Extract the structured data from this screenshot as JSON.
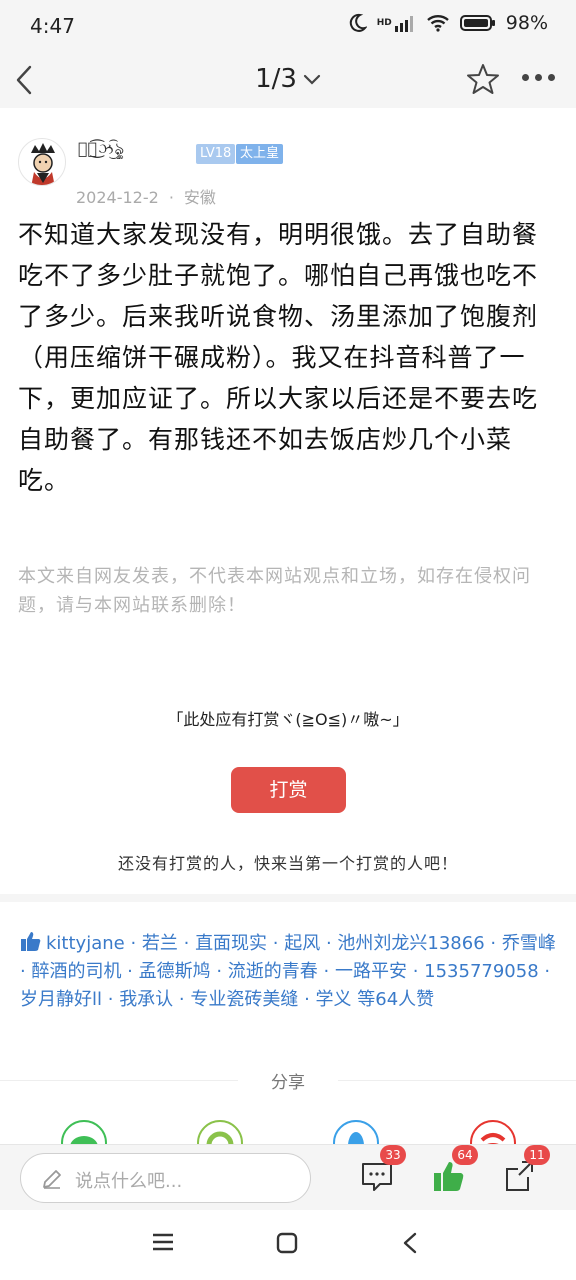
{
  "status_bar": {
    "time": "4:47",
    "battery": "98%",
    "network": "HD"
  },
  "nav": {
    "title": "1/3"
  },
  "author": {
    "name": "ৡৢ͜͡ઝ͜͡ৡৢ",
    "level": "LV18",
    "title_badge": "太上皇",
    "date": "2024-12-2",
    "location": "安徽"
  },
  "post": {
    "body": "不知道大家发现没有，明明很饿。去了自助餐吃不了多少肚子就饱了。哪怕自己再饿也吃不了多少。后来我听说食物、汤里添加了饱腹剂（用压缩饼干碾成粉）。我又在抖音科普了一下，更加应证了。所以大家以后还是不要去吃自助餐了。有那钱还不如去饭店炒几个小菜吃。",
    "disclaimer": "本文来自网友发表，不代表本网站观点和立场，如存在侵权问题，请与本网站联系删除！"
  },
  "reward": {
    "prompt": "「此处应有打赏ヾ(≧O≦)〃嗷~」",
    "button_label": "打赏",
    "note": "还没有打赏的人，快来当第一个打赏的人吧！"
  },
  "likes": {
    "users": [
      "kittyjane",
      "若兰",
      "直面现实",
      "起风",
      "池州刘龙兴13866",
      "乔雪峰",
      "醉酒的司机",
      "孟德斯鸠",
      "流逝的青春",
      "一路平安",
      "1535779058",
      "岁月静好ll",
      "我承认",
      "专业瓷砖美缝",
      "学义"
    ],
    "summary": "等64人赞"
  },
  "share": {
    "label": "分享"
  },
  "bottom_bar": {
    "comment_placeholder": "说点什么吧...",
    "comment_count": "33",
    "like_count": "64",
    "share_count": "11"
  },
  "colors": {
    "accent_red": "#e15049",
    "link_blue": "#3a7ac9",
    "like_green": "#3fae49",
    "badge_red": "#e84a4a"
  },
  "icons": {
    "nav": [
      "back-icon",
      "chevron-down-icon",
      "star-icon",
      "more-icon"
    ],
    "share": [
      "wechat-icon",
      "moments-icon",
      "qq-icon",
      "weibo-icon"
    ],
    "bottom": [
      "pen-icon",
      "comment-icon",
      "thumbs-up-icon",
      "share-icon"
    ]
  }
}
